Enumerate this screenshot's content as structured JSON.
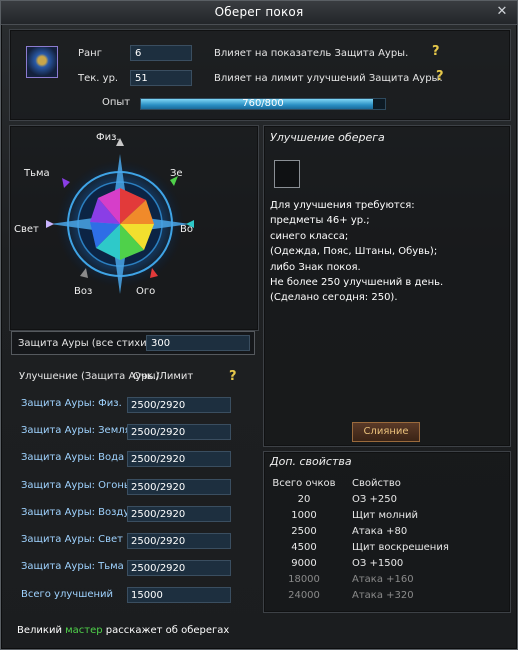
{
  "window": {
    "title": "Оберег покоя"
  },
  "top": {
    "rank_label": "Ранг",
    "rank_value": "6",
    "rank_note": "Влияет на показатель Защита Ауры.",
    "level_label": "Тек. ур.",
    "level_value": "51",
    "level_note": "Влияет на лимит улучшений Защита Ауры.",
    "exp_label": "Опыт",
    "exp_text": "760/800",
    "exp_fraction": 0.95
  },
  "compass": {
    "labels": {
      "fiz": "Физ.",
      "tma": "Тьма",
      "ze": "Зе",
      "svet": "Свет",
      "vo": "Во",
      "voz": "Воз",
      "ogo": "Ого"
    }
  },
  "aura": {
    "label": "Защита Ауры (все стихии)",
    "value": "300"
  },
  "upgrades": {
    "header": "Улучшение (Защита Ауры)",
    "limit_header": "Очк./Лимит",
    "rows": [
      {
        "label": "Защита Ауры: Физ.",
        "value": "2500/2920"
      },
      {
        "label": "Защита Ауры: Земля",
        "value": "2500/2920"
      },
      {
        "label": "Защита Ауры: Вода",
        "value": "2500/2920"
      },
      {
        "label": "Защита Ауры: Огонь",
        "value": "2500/2920"
      },
      {
        "label": "Защита Ауры: Воздух",
        "value": "2500/2920"
      },
      {
        "label": "Защита Ауры: Свет",
        "value": "2500/2920"
      },
      {
        "label": "Защита Ауры: Тьма",
        "value": "2500/2920"
      }
    ],
    "total_label": "Всего улучшений",
    "total_value": "15000"
  },
  "improve": {
    "header": "Улучшение оберега",
    "req_lines": [
      "Для улучшения требуются:",
      "предметы 46+ ур.;",
      "синего класса;",
      "(Одежда, Пояс, Штаны, Обувь);",
      "либо Знак покоя.",
      "Не более 250 улучшений в день.",
      "(Сделано сегодня: 250)."
    ],
    "merge_button": "Слияние"
  },
  "props": {
    "header": "Доп. свойства",
    "col1": "Всего очков",
    "col2": "Свойство",
    "rows": [
      {
        "points": "20",
        "prop": "ОЗ +250",
        "active": true
      },
      {
        "points": "1000",
        "prop": "Щит молний",
        "active": true
      },
      {
        "points": "2500",
        "prop": "Атака +80",
        "active": true
      },
      {
        "points": "4500",
        "prop": "Щит воскрешения",
        "active": true
      },
      {
        "points": "9000",
        "prop": "ОЗ +1500",
        "active": true
      },
      {
        "points": "18000",
        "prop": "Атака +160",
        "active": false
      },
      {
        "points": "24000",
        "prop": "Атака +320",
        "active": false
      }
    ]
  },
  "footer": {
    "prefix": "Великий ",
    "highlight": "мастер",
    "suffix": " расскажет об оберегах"
  },
  "colors": {
    "accent": "#9fd3ff",
    "highlight": "#4fd14a",
    "gold": "#e6c84a",
    "inactive": "#8a8a8a"
  }
}
